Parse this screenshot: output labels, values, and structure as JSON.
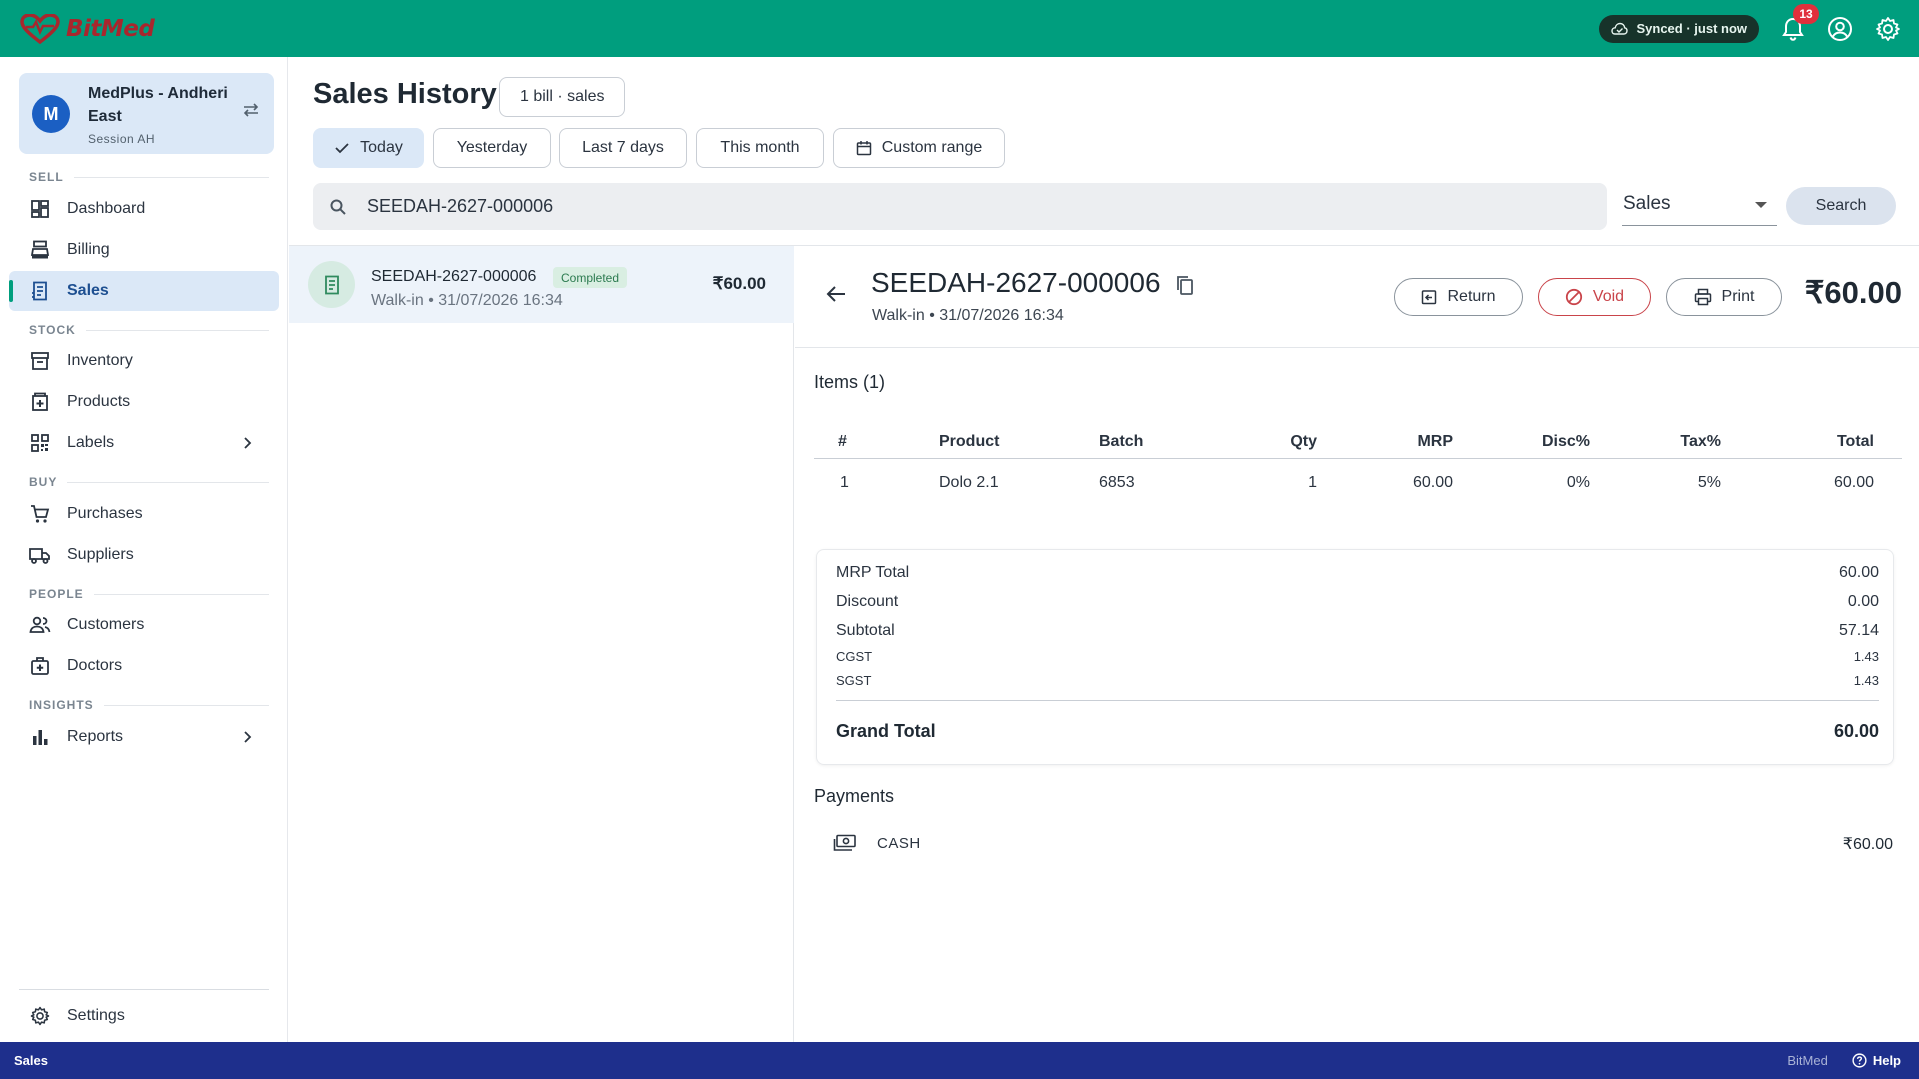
{
  "app": {
    "brand": "BitMed"
  },
  "topbar": {
    "sync_status": "Synced · just now",
    "notification_count": "13"
  },
  "store": {
    "avatar_letter": "M",
    "name": "MedPlus - Andheri East",
    "session": "Session AH"
  },
  "sidebar": {
    "sections": {
      "sell": "SELL",
      "stock": "STOCK",
      "buy": "BUY",
      "people": "PEOPLE",
      "insights": "INSIGHTS"
    },
    "items": {
      "dashboard": "Dashboard",
      "billing": "Billing",
      "sales": "Sales",
      "inventory": "Inventory",
      "products": "Products",
      "labels": "Labels",
      "purchases": "Purchases",
      "suppliers": "Suppliers",
      "customers": "Customers",
      "doctors": "Doctors",
      "reports": "Reports",
      "settings": "Settings"
    },
    "active": "Sales"
  },
  "header": {
    "title": "Sales History",
    "count_pill": "1 bill · sales",
    "filters": {
      "today": "Today",
      "yesterday": "Yesterday",
      "last7": "Last 7 days",
      "month": "This month",
      "custom": "Custom range"
    },
    "active_filter": "Today"
  },
  "search": {
    "value": "SEEDAH-2627-000006",
    "type": "Sales",
    "button": "Search"
  },
  "bills": [
    {
      "number": "SEEDAH-2627-000006",
      "status": "Completed",
      "meta": "Walk-in • 31/07/2026 16:34",
      "amount": "₹60.00"
    }
  ],
  "detail": {
    "number": "SEEDAH-2627-000006",
    "meta": "Walk-in • 31/07/2026 16:34",
    "actions": {
      "return": "Return",
      "void": "Void",
      "print": "Print"
    },
    "total": "₹60.00",
    "items_title": "Items (1)",
    "columns": {
      "idx": "#",
      "product": "Product",
      "batch": "Batch",
      "qty": "Qty",
      "mrp": "MRP",
      "disc": "Disc%",
      "tax": "Tax%",
      "total": "Total"
    },
    "items": [
      {
        "idx": "1",
        "product": "Dolo 2.1",
        "batch": "6853",
        "qty": "1",
        "mrp": "60.00",
        "disc": "0%",
        "tax": "5%",
        "total": "60.00"
      }
    ],
    "summary": {
      "mrp_total_label": "MRP Total",
      "mrp_total": "60.00",
      "discount_label": "Discount",
      "discount": "0.00",
      "subtotal_label": "Subtotal",
      "subtotal": "57.14",
      "cgst_label": "CGST",
      "cgst": "1.43",
      "sgst_label": "SGST",
      "sgst": "1.43",
      "grand_total_label": "Grand Total",
      "grand_total": "60.00"
    },
    "payments_title": "Payments",
    "payments": [
      {
        "method": "CASH",
        "amount": "₹60.00"
      }
    ]
  },
  "statusbar": {
    "left": "Sales",
    "brand": "BitMed",
    "help": "Help"
  },
  "colors": {
    "topbar": "#009e7e",
    "statusbar": "#1e2f8c",
    "active_nav": "#dbe8f7",
    "brand_red": "#a8272d",
    "void": "#c9444a"
  }
}
